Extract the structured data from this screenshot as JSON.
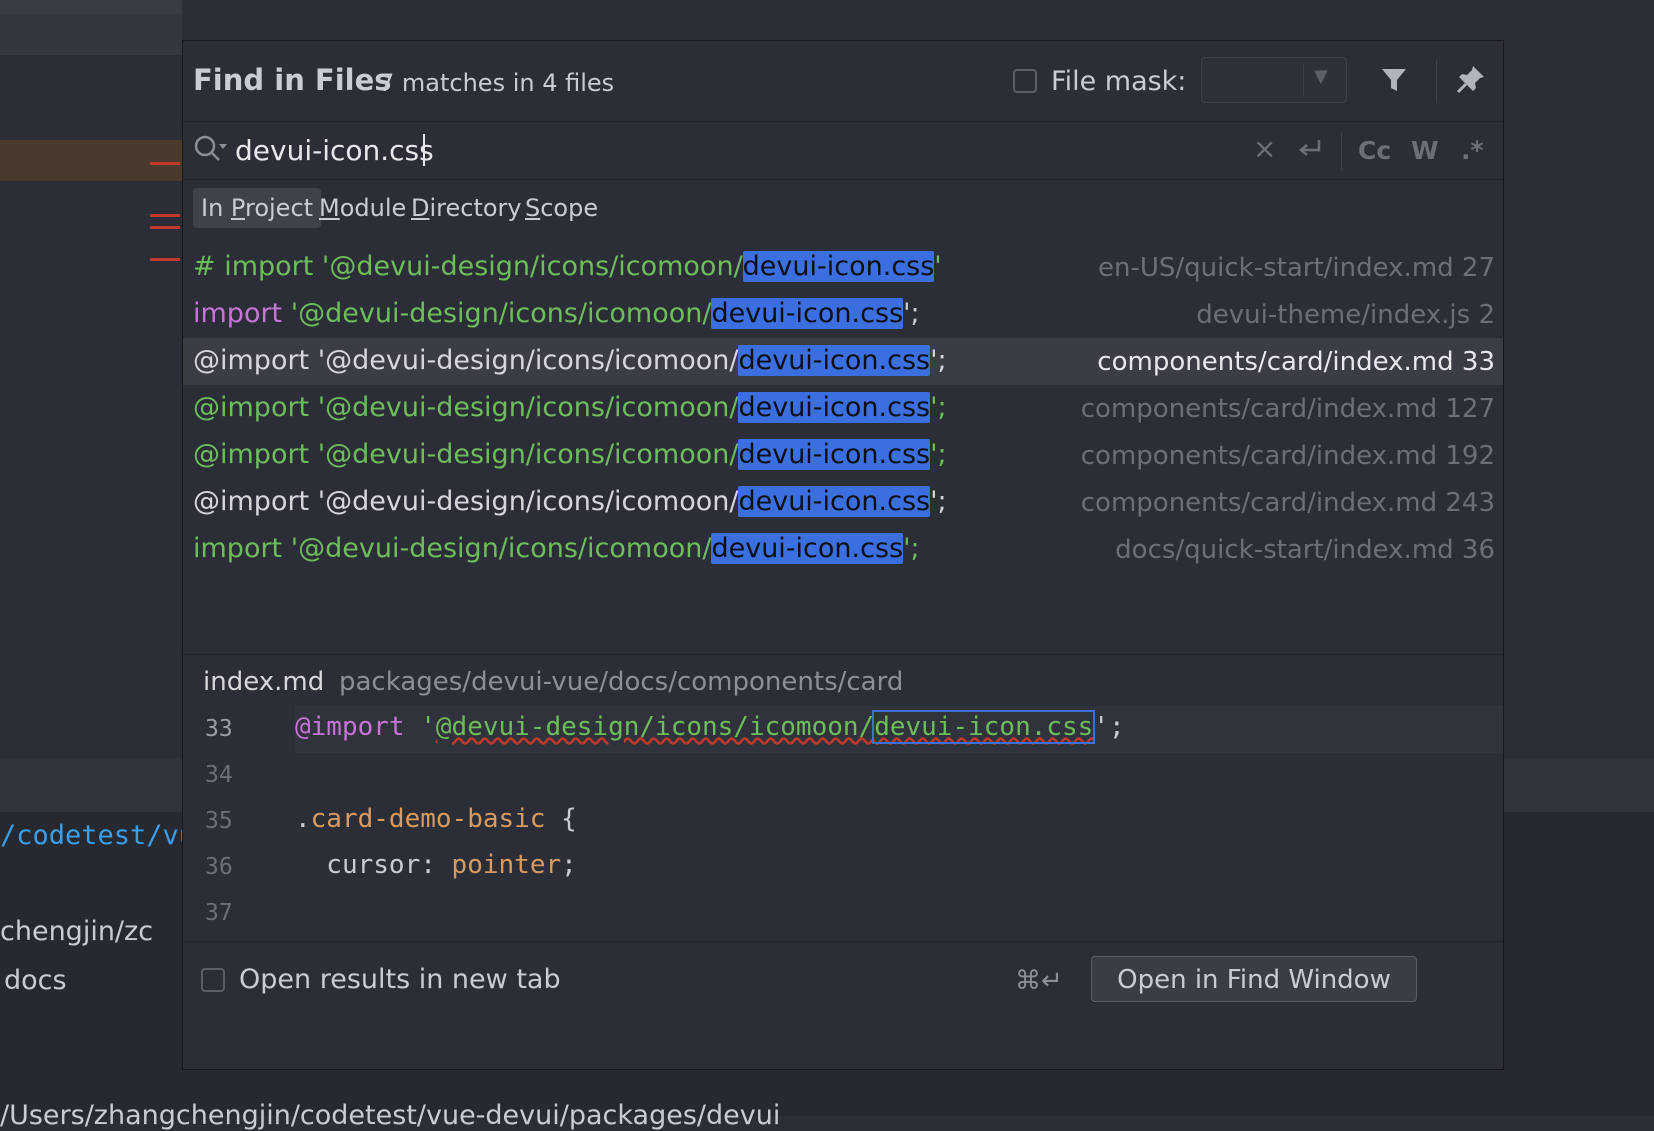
{
  "background": {
    "path_fragment": "/codetest/vu",
    "name_fragment": "chengjin/zc",
    "docs_fragment": "docs",
    "bottom_fragment": "/Users/zhangchengjin/codetest/vue-devui/packages/devui"
  },
  "dialog": {
    "title": "Find in Files",
    "subtitle": "7 matches in 4 files",
    "file_mask_label": "File mask:",
    "file_mask_value": ""
  },
  "search": {
    "value": "devui-icon.css",
    "options": {
      "case": "Cc",
      "words": "W",
      "regex": ".*"
    }
  },
  "scopes": [
    {
      "prefix": "In ",
      "mn": "P",
      "rest": "roject",
      "active": true
    },
    {
      "prefix": "",
      "mn": "M",
      "rest": "odule",
      "active": false
    },
    {
      "prefix": "",
      "mn": "D",
      "rest": "irectory",
      "active": false
    },
    {
      "prefix": "",
      "mn": "S",
      "rest": "cope",
      "active": false
    }
  ],
  "results": [
    {
      "pre": "# import '@devui-design/icons/icomoon/",
      "match": "devui-icon.css",
      "post": "'",
      "color": "green",
      "file": "en-US/quick-start/index.md 27"
    },
    {
      "kw": "import ",
      "pre": "'@devui-design/icons/icomoon/",
      "match": "devui-icon.css",
      "post": "';",
      "color": "green",
      "file": "devui-theme/index.js 2"
    },
    {
      "pre": "@import '@devui-design/icons/icomoon/",
      "match": "devui-icon.css",
      "post": "';",
      "color": "white",
      "file": "components/card/index.md 33",
      "selected": true
    },
    {
      "pre": "@import '@devui-design/icons/icomoon/",
      "match": "devui-icon.css",
      "post": "';",
      "color": "green",
      "file": "components/card/index.md 127"
    },
    {
      "pre": "@import '@devui-design/icons/icomoon/",
      "match": "devui-icon.css",
      "post": "';",
      "color": "green",
      "file": "components/card/index.md 192"
    },
    {
      "pre": "@import '@devui-design/icons/icomoon/",
      "match": "devui-icon.css",
      "post": "';",
      "color": "white",
      "file": "components/card/index.md 243"
    },
    {
      "pre": "import '@devui-design/icons/icomoon/",
      "match": "devui-icon.css",
      "post": "';",
      "color": "green",
      "file": "docs/quick-start/index.md 36"
    }
  ],
  "preview": {
    "file_name": "index.md",
    "file_path": "packages/devui-vue/docs/components/card",
    "lines": [
      {
        "n": "33",
        "at": "@import",
        "sp": " ",
        "q": "'",
        "str": "@devui-design/icons/icomoon/",
        "match": "devui-icon.css",
        "end": "';"
      },
      {
        "n": "34"
      },
      {
        "n": "35",
        "dot": ".",
        "cls": "card-demo-basic",
        "brace": " {"
      },
      {
        "n": "36",
        "prop": "  cursor: ",
        "val": "pointer",
        "semi": ";"
      },
      {
        "n": "37"
      }
    ]
  },
  "footer": {
    "checkbox_label": "Open results in new tab",
    "shortcut": "⌘↵",
    "button_label": "Open in Find Window"
  },
  "colors": {
    "accent": "#3b6fe0",
    "match_green": "#6ebd5c",
    "keyword_pink": "#c774d9",
    "css_orange": "#d79b62"
  }
}
